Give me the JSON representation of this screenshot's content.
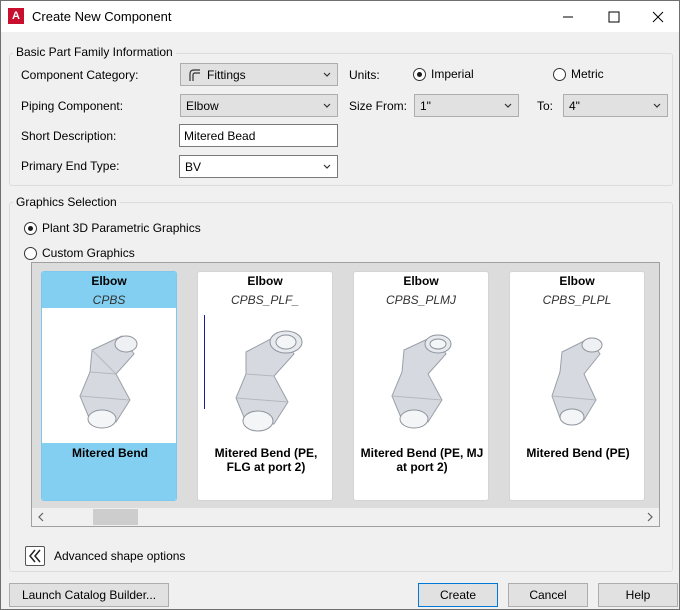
{
  "window": {
    "title": "Create New Component",
    "app_icon_letter": "A",
    "controls": [
      "minimize-icon",
      "maximize-icon",
      "close-icon"
    ]
  },
  "basic_info": {
    "legend": "Basic Part Family Information",
    "component_category_label": "Component Category:",
    "component_category_value": "Fittings",
    "piping_component_label": "Piping Component:",
    "piping_component_value": "Elbow",
    "short_description_label": "Short Description:",
    "short_description_value": "Mitered Bead",
    "primary_end_type_label": "Primary End Type:",
    "primary_end_type_value": "BV",
    "units_label": "Units:",
    "units_options": [
      {
        "label": "Imperial",
        "selected": true
      },
      {
        "label": "Metric",
        "selected": false
      }
    ],
    "size_from_label": "Size From:",
    "size_from_value": "1\"",
    "to_label": "To:",
    "to_value": "4\""
  },
  "graphics": {
    "legend": "Graphics Selection",
    "options": [
      {
        "label": "Plant 3D Parametric Graphics",
        "selected": true
      },
      {
        "label": "Custom Graphics",
        "selected": false
      }
    ],
    "cards": [
      {
        "name": "Elbow",
        "code": "CPBS",
        "description": "Mitered Bend",
        "selected": true
      },
      {
        "name": "Elbow",
        "code": "CPBS_PLF_",
        "description": "Mitered Bend (PE, FLG at port 2)",
        "selected": false
      },
      {
        "name": "Elbow",
        "code": "CPBS_PLMJ",
        "description": "Mitered Bend (PE, MJ at port 2)",
        "selected": false
      },
      {
        "name": "Elbow",
        "code": "CPBS_PLPL",
        "description": "Mitered Bend (PE)",
        "selected": false
      }
    ],
    "scroll_position": 0.05
  },
  "advanced": {
    "label": "Advanced shape options"
  },
  "footer": {
    "launch_label": "Launch Catalog Builder...",
    "create_label": "Create",
    "cancel_label": "Cancel",
    "help_label": "Help"
  },
  "colors": {
    "selection": "#82cff2",
    "window_bg": "#f0f0f0"
  }
}
